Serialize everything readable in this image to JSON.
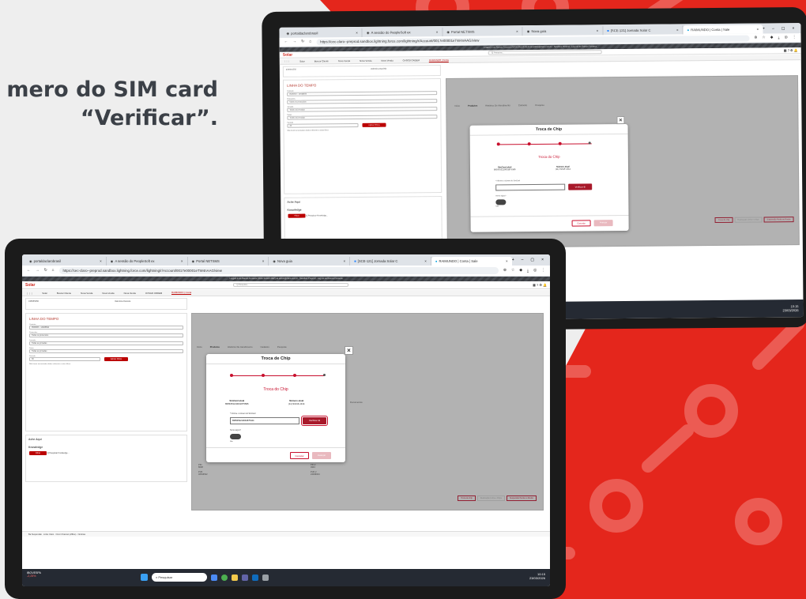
{
  "caption": {
    "line1": "mero do SIM card",
    "line2": "“Verificar”."
  },
  "browser": {
    "tabs": [
      "portaldaclarobrasil",
      "A sessão do PeopleSoft ex",
      "Portal NETSMS",
      "Nova guia",
      "[SCE-121] Jornada Solar C",
      "RAIMUNDO | Conta | Sale"
    ],
    "url": "https://cec-claro--preprod.sandbox.lightning.force.com/lightning/r/Account/0017e00001eTW4nAAG/view",
    "banner": "Logged in as Ramos Fonseca (NGIA SALES REP) as admin@claro.com.br · Sandbox Preprod · Log out as Ramos Fonseca"
  },
  "salesforce": {
    "logo": "Solar",
    "search_placeholder": "Q Pesquisa...",
    "nav": [
      "Solar",
      "Buscar Cliente",
      "Nova Venda",
      "Nova Venda",
      "Nova Venda",
      "OVSGD ORDEM",
      "RAIMUNDO | Conta"
    ],
    "account_no": "435655350",
    "account_name": "Valentina Daniela",
    "timeline_title": "LINHA DO TEMPO",
    "timeline_fields": [
      {
        "label": "Contrato",
        "value": "0546053 - 14928694"
      },
      {
        "label": "Protocolos",
        "value": "Todos os protocolos"
      },
      {
        "label": "Jornada",
        "value": "Todas as jornadas"
      },
      {
        "label": "Status",
        "value": "Todos os acontecimentos"
      },
      {
        "label": "Datas",
        "value": "Todas as jornadas"
      },
      {
        "label": "Período de datas",
        "value": "Todos os acontecimentos"
      },
      {
        "label": "Período",
        "value": "30"
      }
    ],
    "apply_filters": "Aplicar Filtros",
    "no_data": "Não foram encontrados dados referente a estes filtros",
    "acheaqui": "Ache Aqui",
    "knowledge": "Knowledge",
    "knowledge_btn": "Filtrar",
    "knowledge_placeholder": "Q  Pesquisar Knowledge...",
    "main_tabs": [
      "Início",
      "Produtos",
      "Histórico De Atendimento",
      "Cadastro",
      "Pesquisa"
    ],
    "documents": "Documentos",
    "pin": {
      "pin1_label": "PIN",
      "pin1": "8038",
      "pin2_label": "PIN 2",
      "pin2": "4943",
      "puk1_label": "PUK",
      "puk1": "40543542",
      "puk2_label": "PUK 2",
      "puk2": "24036024"
    },
    "action_buttons": [
      "Troca de chip",
      "Reativação Linha e Chips",
      "Suspensão Perda ou Roubo"
    ],
    "util_bar": "Ba Suspensão  ·  Links Claro  ·  Omni Channel (offline)  ·  Notícias"
  },
  "modal": {
    "header": "Troca de Chip",
    "title": "Troca do Chip",
    "sim_label": "SimCard atual",
    "sim_value": "8955053210001875586",
    "num_label": "Número atual",
    "num_value": "(11) 91316-1314",
    "input_label": "* Informe o número do SimCard",
    "input_value": "8955053210001875444",
    "verify": "Verificar",
    "toggle_label": "Termo signo?",
    "toggle_state": "Não",
    "cancel": "Cancelar",
    "submit": "Avançar"
  },
  "taskbar": {
    "stock_name": "IBOVESPA",
    "stock_change": "-2,25%",
    "search": "Pesquisar",
    "time": "10:15",
    "date": "23/03/2026"
  },
  "colors": {
    "brand_red": "#c8102e",
    "claro_red": "#e4261c",
    "button_red": "#a8192a"
  }
}
